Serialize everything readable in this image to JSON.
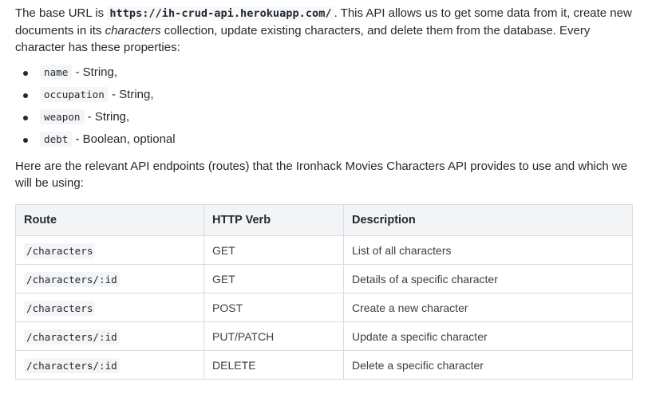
{
  "intro": {
    "prefix": "The base URL is ",
    "url": "https://ih-crud-api.herokuapp.com/",
    "middle": ". This API allows us to get some data from it, create new documents in its ",
    "collection": "characters",
    "suffix": " collection, update existing characters, and delete them from the database. Every character has these properties:"
  },
  "properties": [
    {
      "name": "name",
      "desc": " - String,"
    },
    {
      "name": "occupation",
      "desc": " - String,"
    },
    {
      "name": "weapon",
      "desc": " - String,"
    },
    {
      "name": "debt",
      "desc": " - Boolean, optional"
    }
  ],
  "endpoints_intro": "Here are the relevant API endpoints (routes) that the Ironhack Movies Characters API provides to use and which we will be using:",
  "table": {
    "headers": [
      "Route",
      "HTTP Verb",
      "Description"
    ],
    "rows": [
      {
        "route": "/characters",
        "verb": "GET",
        "description": "List of all characters"
      },
      {
        "route": "/characters/:id",
        "verb": "GET",
        "description": "Details of a specific character"
      },
      {
        "route": "/characters",
        "verb": "POST",
        "description": "Create a new character"
      },
      {
        "route": "/characters/:id",
        "verb": "PUT/PATCH",
        "description": "Update a specific character"
      },
      {
        "route": "/characters/:id",
        "verb": "DELETE",
        "description": "Delete a specific character"
      }
    ]
  }
}
